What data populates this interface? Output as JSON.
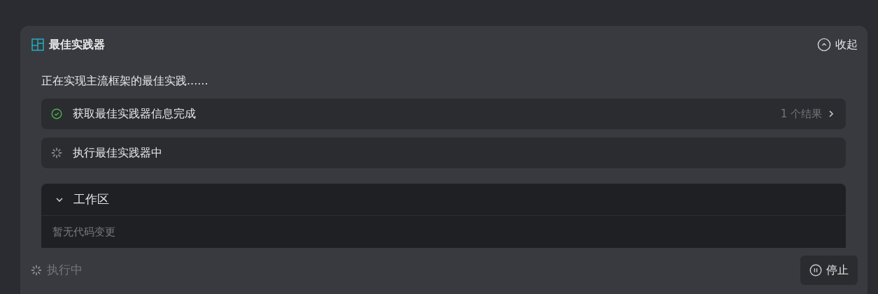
{
  "panel": {
    "title": "最佳实践器",
    "collapse_label": "收起"
  },
  "description": "正在实现主流框架的最佳实践......",
  "steps": [
    {
      "kind": "done",
      "label": "获取最佳实践器信息完成",
      "result": "1 个结果"
    },
    {
      "kind": "running",
      "label": "执行最佳实践器中"
    }
  ],
  "workspace": {
    "title": "工作区",
    "expanded": true,
    "empty_text": "暂无代码变更"
  },
  "footer": {
    "status": "执行中",
    "stop_label": "停止"
  }
}
